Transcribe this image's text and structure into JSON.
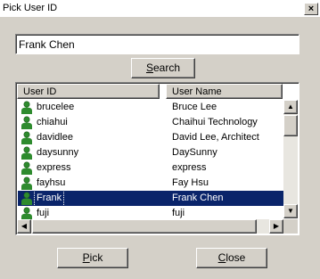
{
  "window": {
    "title": "Pick User ID",
    "close_glyph": "×"
  },
  "search": {
    "value": "Frank Chen",
    "button_accel": "S",
    "button_rest": "earch"
  },
  "list": {
    "columns": [
      "User ID",
      "User Name"
    ],
    "rows": [
      {
        "id": "brucelee",
        "name": "Bruce Lee"
      },
      {
        "id": "chiahui",
        "name": "Chaihui Technology"
      },
      {
        "id": "davidlee",
        "name": "David Lee, Architect"
      },
      {
        "id": "daysunny",
        "name": "DaySunny"
      },
      {
        "id": "express",
        "name": "express"
      },
      {
        "id": "fayhsu",
        "name": "Fay Hsu"
      },
      {
        "id": "Frank",
        "name": "Frank Chen",
        "selected": true
      },
      {
        "id": "fuji",
        "name": "fuji"
      }
    ]
  },
  "buttons": {
    "pick_accel": "P",
    "pick_rest": "ick",
    "close_accel": "C",
    "close_rest": "lose"
  },
  "colors": {
    "selection": "#0a246a",
    "face": "#d4d0c8",
    "user_icon": "#2e8b2e"
  }
}
